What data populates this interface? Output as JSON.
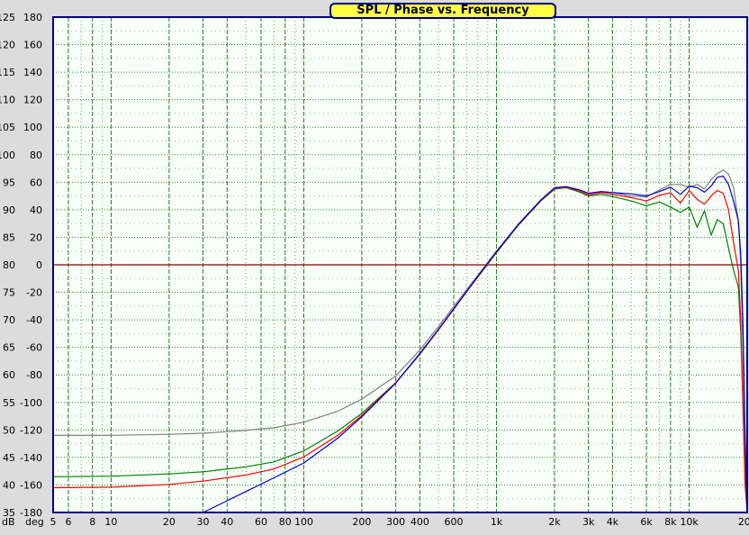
{
  "title": "SPL / Phase vs. Frequency",
  "chart_data": {
    "type": "line",
    "title": "SPL / Phase vs. Frequency",
    "x_scale": "log",
    "xlim": [
      5,
      20000
    ],
    "ylim_spl": [
      35,
      125
    ],
    "ylim_phase": [
      -180,
      180
    ],
    "spl_unit": "dB",
    "phase_unit": "deg",
    "x_ticks": [
      5,
      6,
      8,
      10,
      20,
      30,
      40,
      60,
      80,
      100,
      200,
      300,
      400,
      600,
      1000,
      2000,
      3000,
      4000,
      6000,
      8000,
      10000,
      20000
    ],
    "x_tick_labels": [
      "5",
      "6",
      "8",
      "10",
      "20",
      "30",
      "40",
      "60",
      "80",
      "100",
      "200",
      "300",
      "400",
      "600",
      "1k",
      "2k",
      "3k",
      "4k",
      "6k",
      "8k",
      "10k",
      "20k"
    ],
    "spl_ticks": [
      125,
      120,
      115,
      110,
      105,
      100,
      95,
      90,
      85,
      80,
      75,
      70,
      65,
      60,
      55,
      50,
      45,
      40,
      35
    ],
    "phase_ticks": [
      180,
      160,
      140,
      120,
      100,
      80,
      60,
      40,
      20,
      0,
      -20,
      -40,
      -60,
      -80,
      -100,
      -120,
      -140,
      -160,
      -180
    ],
    "reference_line": {
      "phase": 0,
      "color": "#8b0000"
    },
    "grid": true,
    "background": "#f8fff8",
    "grid_color": "#006400",
    "series": [
      {
        "color": "#808080",
        "x": [
          5,
          10,
          20,
          30,
          50,
          70,
          100,
          150,
          200,
          300,
          400,
          500,
          700,
          1000,
          1300,
          1700,
          2000,
          2300,
          2700,
          3000,
          3500,
          4000,
          5000,
          6000,
          7000,
          8000,
          9000,
          10000,
          11000,
          12000,
          13000,
          14000,
          15000,
          16000,
          17000,
          18000,
          18500,
          19000,
          19500,
          20000
        ],
        "y": [
          49.0,
          49.0,
          49.2,
          49.4,
          49.9,
          50.4,
          51.4,
          53.4,
          55.6,
          59.8,
          64.5,
          68.8,
          75.5,
          82.5,
          87.3,
          91.6,
          93.7,
          94.1,
          93.6,
          93.0,
          93.3,
          93.1,
          92.5,
          92.3,
          93.6,
          94.6,
          94.6,
          94.1,
          94.6,
          93.8,
          95.5,
          96.6,
          97.2,
          96.5,
          94.0,
          88.0,
          80.0,
          65.0,
          45.0,
          35.0
        ]
      },
      {
        "color": "#008000",
        "x": [
          5,
          10,
          20,
          30,
          50,
          70,
          100,
          150,
          200,
          300,
          400,
          500,
          700,
          1000,
          1300,
          1700,
          2000,
          2300,
          2700,
          3000,
          3500,
          4000,
          5000,
          6000,
          7000,
          8000,
          9000,
          10000,
          11000,
          12000,
          13000,
          14000,
          15000,
          16000,
          17000,
          18000,
          18500,
          19000,
          19500,
          20000
        ],
        "y": [
          41.5,
          41.6,
          42.0,
          42.4,
          43.3,
          44.2,
          46.2,
          49.8,
          53.0,
          58.6,
          63.7,
          68.2,
          75.1,
          82.2,
          87.2,
          91.6,
          93.8,
          94.0,
          93.2,
          92.5,
          92.8,
          92.4,
          91.6,
          90.7,
          91.4,
          90.5,
          89.5,
          90.5,
          86.8,
          89.8,
          85.4,
          88.2,
          87.5,
          83.0,
          79.0,
          76.0,
          68.0,
          55.0,
          42.0,
          35.0
        ]
      },
      {
        "color": "#ff0000",
        "x": [
          5,
          10,
          20,
          30,
          50,
          70,
          100,
          150,
          200,
          300,
          400,
          500,
          700,
          1000,
          1300,
          1700,
          2000,
          2300,
          2700,
          3000,
          3500,
          4000,
          5000,
          6000,
          7000,
          8000,
          9000,
          10000,
          11000,
          12000,
          13000,
          14000,
          15000,
          16000,
          17000,
          18000,
          18500,
          19000,
          19500,
          20000
        ],
        "y": [
          39.5,
          39.6,
          40.1,
          40.7,
          41.8,
          42.9,
          45.1,
          49.0,
          52.6,
          58.6,
          63.8,
          68.2,
          75.1,
          82.3,
          87.3,
          91.7,
          93.9,
          94.1,
          93.4,
          92.7,
          93.1,
          92.8,
          92.2,
          91.6,
          92.6,
          93.1,
          91.2,
          93.5,
          91.9,
          91.0,
          92.5,
          93.5,
          93.0,
          90.0,
          84.0,
          79.0,
          70.0,
          55.0,
          40.0,
          35.0
        ]
      },
      {
        "color": "#0000cd",
        "x": [
          30,
          50,
          70,
          100,
          150,
          200,
          300,
          400,
          500,
          700,
          1000,
          1300,
          1700,
          2000,
          2300,
          2700,
          3000,
          3500,
          4000,
          5000,
          6000,
          7000,
          8000,
          9000,
          10000,
          11000,
          12000,
          13000,
          14000,
          15000,
          16000,
          17000,
          18000,
          18500,
          19000,
          19500,
          20000
        ],
        "y": [
          35.0,
          38.8,
          41.3,
          44.0,
          48.5,
          52.4,
          58.5,
          63.9,
          68.3,
          75.2,
          82.4,
          87.4,
          91.8,
          94.0,
          94.2,
          93.6,
          93.0,
          93.3,
          93.1,
          92.9,
          92.5,
          93.3,
          94.1,
          92.8,
          94.3,
          94.0,
          93.2,
          94.3,
          95.9,
          96.1,
          94.6,
          91.5,
          88.0,
          82.0,
          70.0,
          50.0,
          35.0
        ]
      }
    ]
  }
}
